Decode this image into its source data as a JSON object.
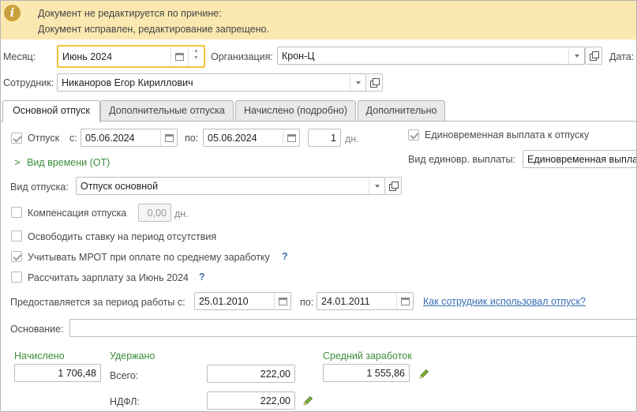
{
  "banner": {
    "line1": "Документ не редактируется по причине:",
    "line2": "Документ исправлен, редактирование запрещено."
  },
  "header": {
    "month_label": "Месяц:",
    "month_value": "Июнь 2024",
    "org_label": "Организация:",
    "org_value": "Крон-Ц",
    "date_label": "Дата:",
    "employee_label": "Сотрудник:",
    "employee_value": "Никаноров Егор Кириллович"
  },
  "tabs": [
    {
      "label": "Основной отпуск",
      "active": true
    },
    {
      "label": "Дополнительные отпуска",
      "active": false
    },
    {
      "label": "Начислено (подробно)",
      "active": false
    },
    {
      "label": "Дополнительно",
      "active": false
    }
  ],
  "vacation": {
    "checked": true,
    "label": "Отпуск",
    "from_label": "с:",
    "from": "05.06.2024",
    "to_label": "по:",
    "to": "05.06.2024",
    "days": "1",
    "days_unit": "дн.",
    "time_type_link": "Вид времени (ОТ)",
    "type_label": "Вид отпуска:",
    "type_value": "Отпуск основной"
  },
  "lump_sum": {
    "checked": true,
    "label": "Единовременная выплата к отпуску",
    "kind_label": "Вид единовр. выплаты:",
    "kind_value": "Единовременная выпла"
  },
  "options": {
    "compensation_label": "Компенсация отпуска",
    "compensation_value": "0,00",
    "compensation_unit": "дн.",
    "release_rate_label": "Освободить ставку на период отсутствия",
    "mrot_label": "Учитывать МРОТ при оплате по среднему заработку",
    "salary_label": "Рассчитать зарплату за Июнь 2024",
    "help_mark": "?"
  },
  "period": {
    "label": "Предоставляется за период работы с:",
    "from": "25.01.2010",
    "to_label": "по:",
    "to": "24.01.2011",
    "usage_link": "Как сотрудник использовал отпуск?"
  },
  "basis": {
    "label": "Основание:",
    "value": ""
  },
  "totals": {
    "accrued_label": "Начислено",
    "accrued_value": "1 706,48",
    "withheld_label": "Удержано",
    "total_label": "Всего:",
    "total_value": "222,00",
    "ndfl_label": "НДФЛ:",
    "ndfl_value": "222,00",
    "avg_label": "Средний заработок",
    "avg_value": "1 555,86"
  },
  "colors": {
    "banner_bg": "#fbe8b0",
    "accent_yellow": "#f1c43a",
    "link_blue": "#3a6db3",
    "label_green": "#3b8e3b"
  }
}
